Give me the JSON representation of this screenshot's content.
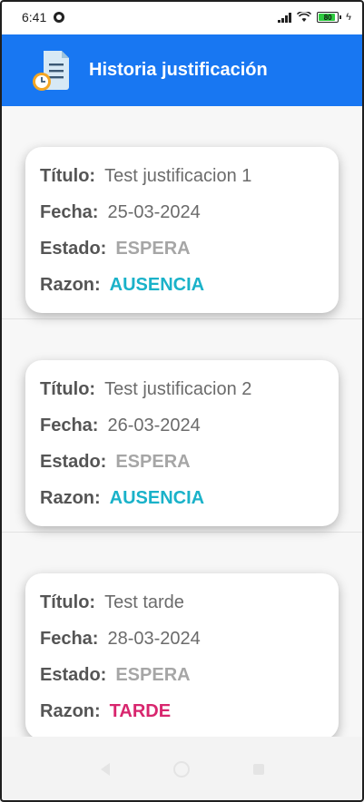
{
  "status_bar": {
    "time": "6:41",
    "battery_level": "80"
  },
  "app_bar": {
    "title": "Historia justificación",
    "logo_icon": "document-clock-icon"
  },
  "labels": {
    "title": "Título:",
    "date": "Fecha:",
    "status": "Estado:",
    "reason": "Razon:"
  },
  "cards": [
    {
      "title": "Test justificacion 1",
      "date": "25-03-2024",
      "status": "ESPERA",
      "reason": "AUSENCIA",
      "reason_color": "#1ab2c9"
    },
    {
      "title": "Test justificacion 2",
      "date": "26-03-2024",
      "status": "ESPERA",
      "reason": "AUSENCIA",
      "reason_color": "#1ab2c9"
    },
    {
      "title": "Test tarde",
      "date": "28-03-2024",
      "status": "ESPERA",
      "reason": "TARDE",
      "reason_color": "#d8266e"
    }
  ],
  "colors": {
    "app_bar": "#1877f2",
    "status_text": "#a6a6a6"
  }
}
